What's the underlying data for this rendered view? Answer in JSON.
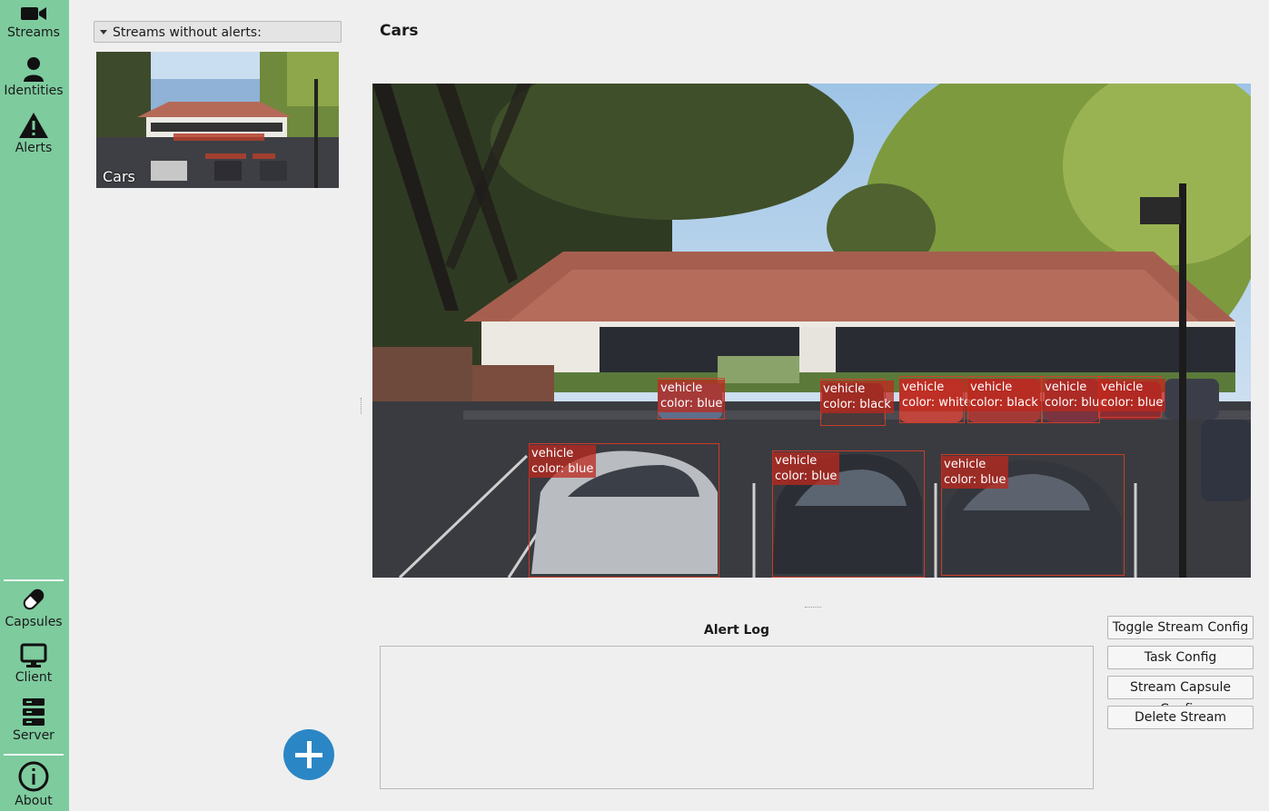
{
  "sidebar": {
    "top_items": [
      {
        "label": "Streams",
        "icon": "video-camera-icon"
      },
      {
        "label": "Identities",
        "icon": "person-icon"
      },
      {
        "label": "Alerts",
        "icon": "warning-icon"
      }
    ],
    "bottom_items": [
      {
        "label": "Capsules",
        "icon": "capsule-icon"
      },
      {
        "label": "Client",
        "icon": "monitor-icon"
      },
      {
        "label": "Server",
        "icon": "server-icon"
      },
      {
        "label": "About",
        "icon": "info-icon"
      }
    ],
    "active_color": "#7ecb9e"
  },
  "left_panel": {
    "filter_label": "Streams without alerts:",
    "streams": [
      {
        "name": "Cars"
      }
    ],
    "add_button_color": "#2b86c5"
  },
  "main": {
    "stream_title": "Cars",
    "detections": [
      {
        "line1": "vehicle",
        "line2": "color: blue"
      },
      {
        "line1": "vehicle",
        "line2": "color: black"
      },
      {
        "line1": "vehicle",
        "line2": "color: white"
      },
      {
        "line1": "vehicle",
        "line2": "color: black"
      },
      {
        "line1": "vehicle",
        "line2": "color: blue"
      },
      {
        "line1": "vehicle",
        "line2": "color: blue"
      },
      {
        "line1": "vehicle",
        "line2": "color: blue"
      },
      {
        "line1": "vehicle",
        "line2": "color: blue"
      },
      {
        "line1": "vehicle",
        "line2": "color: blue"
      }
    ],
    "alert_log_title": "Alert Log",
    "buttons": {
      "toggle_stream_config": "Toggle Stream Config",
      "task_config": "Task Config",
      "stream_capsule_config": "Stream Capsule Config",
      "delete_stream": "Delete Stream"
    }
  }
}
